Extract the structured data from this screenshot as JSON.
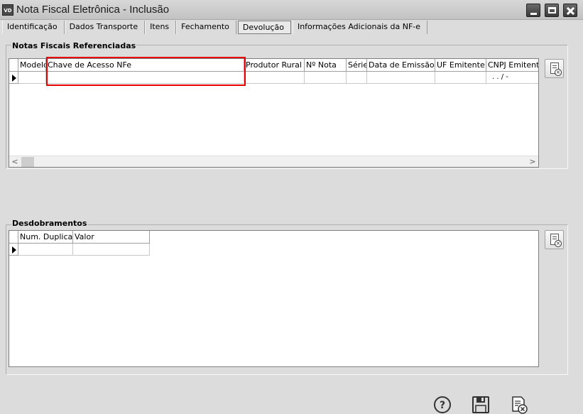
{
  "window": {
    "title": "Nota Fiscal Eletrônica - Inclusão",
    "app_icon_text": "VD"
  },
  "tabs": [
    {
      "label": "Identificação"
    },
    {
      "label": "Dados Transporte"
    },
    {
      "label": "Itens"
    },
    {
      "label": "Fechamento"
    },
    {
      "label": "Devolução",
      "active": true
    },
    {
      "label": "Informações Adicionais da NF-e"
    }
  ],
  "notas_section": {
    "title": "Notas Fiscais Referenciadas",
    "columns": [
      "Modelo",
      "Chave de Acesso NFe",
      "Produtor Rural",
      "Nº Nota",
      "Série",
      "Data de Emissão",
      "UF Emitente",
      "CNPJ Emitente"
    ],
    "rows": [
      {
        "modelo": "",
        "chave": "",
        "produtor": "",
        "nota": "",
        "serie": "",
        "data": "",
        "uf": "",
        "cnpj": ". . /  -"
      }
    ],
    "scroll_left": "<",
    "scroll_right": ">"
  },
  "desdobramentos_section": {
    "title": "Desdobramentos",
    "columns": [
      "Num. Duplicata",
      "Valor"
    ],
    "rows": [
      {
        "duplicata": "",
        "valor": ""
      }
    ]
  },
  "icons": {
    "delete_row": "document-delete-icon",
    "help": "help-icon",
    "save": "save-icon",
    "cancel": "cancel-document-icon"
  },
  "colors": {
    "highlight": "#e60000"
  }
}
